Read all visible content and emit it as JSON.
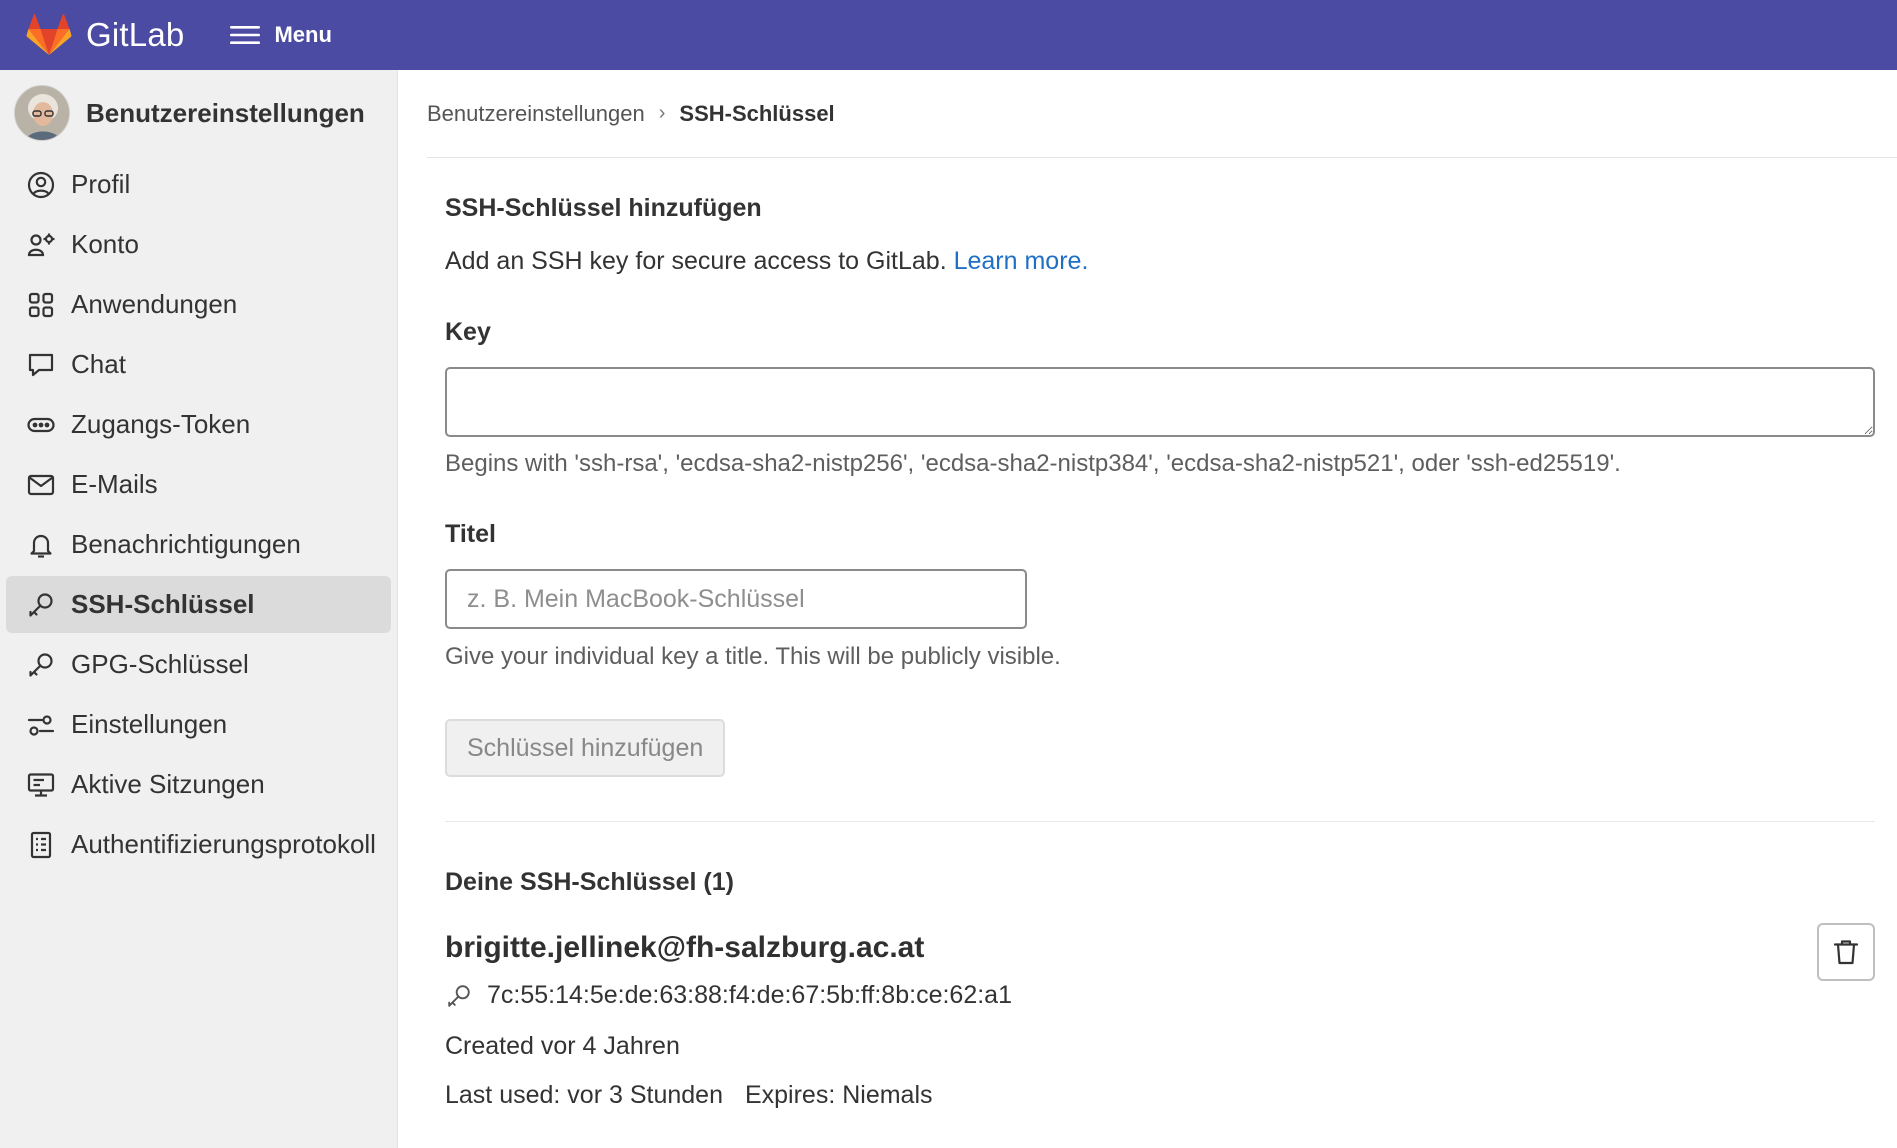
{
  "header": {
    "brand": "GitLab",
    "menu_label": "Menu"
  },
  "sidebar": {
    "title": "Benutzereinstellungen",
    "items": [
      {
        "label": "Profil",
        "icon": "profile-icon"
      },
      {
        "label": "Konto",
        "icon": "account-icon"
      },
      {
        "label": "Anwendungen",
        "icon": "applications-icon"
      },
      {
        "label": "Chat",
        "icon": "chat-icon"
      },
      {
        "label": "Zugangs-Token",
        "icon": "token-icon"
      },
      {
        "label": "E-Mails",
        "icon": "mail-icon"
      },
      {
        "label": "Benachrichtigungen",
        "icon": "bell-icon"
      },
      {
        "label": "SSH-Schlüssel",
        "icon": "key-icon",
        "active": true
      },
      {
        "label": "GPG-Schlüssel",
        "icon": "key-icon"
      },
      {
        "label": "Einstellungen",
        "icon": "preferences-icon"
      },
      {
        "label": "Aktive Sitzungen",
        "icon": "monitor-icon"
      },
      {
        "label": "Authentifizierungsprotokoll",
        "icon": "log-icon"
      }
    ]
  },
  "breadcrumb": {
    "parent": "Benutzereinstellungen",
    "current": "SSH-Schlüssel"
  },
  "add_key": {
    "title": "SSH-Schlüssel hinzufügen",
    "description": "Add an SSH key for secure access to GitLab.",
    "learn_more": "Learn more.",
    "key_label": "Key",
    "key_value": "",
    "key_help": "Begins with 'ssh-rsa', 'ecdsa-sha2-nistp256', 'ecdsa-sha2-nistp384', 'ecdsa-sha2-nistp521', oder 'ssh-ed25519'.",
    "title_label": "Titel",
    "title_value": "",
    "title_placeholder": "z. B. Mein MacBook-Schlüssel",
    "title_help": "Give your individual key a title. This will be publicly visible.",
    "submit_label": "Schlüssel hinzufügen"
  },
  "keys": {
    "heading": "Deine SSH-Schlüssel (1)",
    "items": [
      {
        "owner": "brigitte.jellinek@fh-salzburg.ac.at",
        "fingerprint": "7c:55:14:5e:de:63:88:f4:de:67:5b:ff:8b:ce:62:a1",
        "created": "Created vor 4 Jahren",
        "last_used": "Last used: vor 3 Stunden",
        "expires": "Expires: Niemals"
      }
    ]
  },
  "colors": {
    "topbar": "#4b4ba3",
    "link": "#1f6fc5",
    "sidebar_bg": "#f0f0f0",
    "active_item_bg": "#dbdbdb"
  }
}
